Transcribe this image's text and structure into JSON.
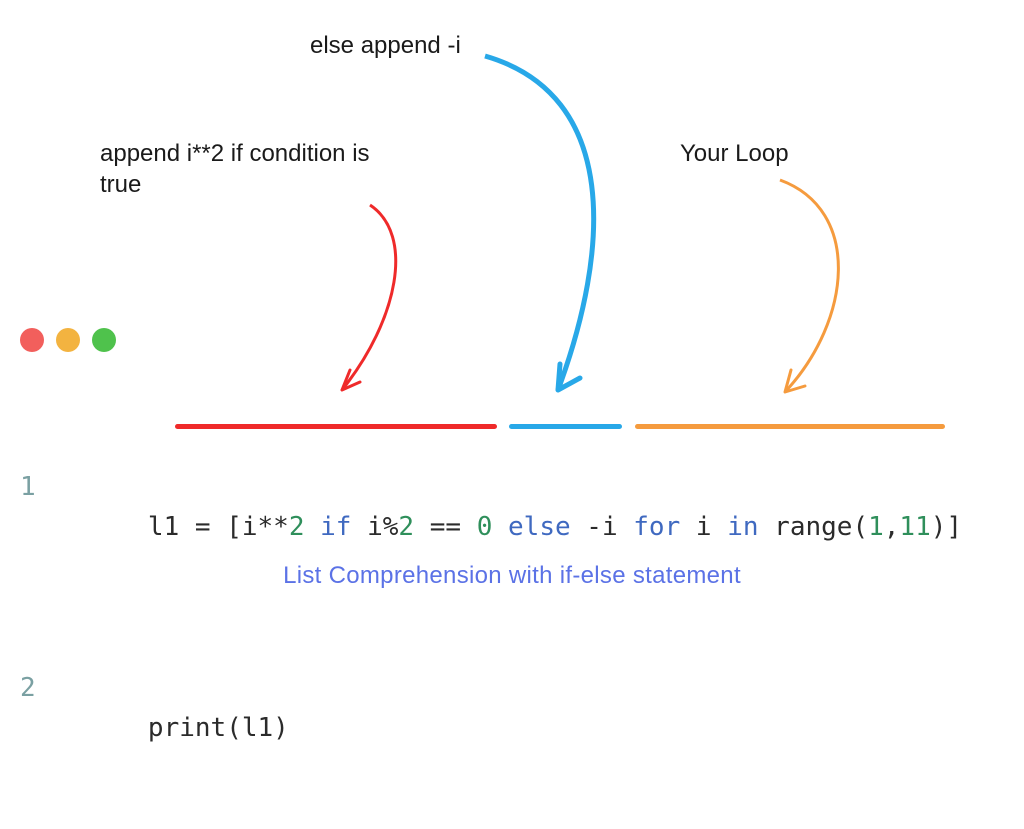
{
  "annotations": {
    "if": "append i**2 if condition is true",
    "else": "else append -i",
    "loop": "Your Loop"
  },
  "dots": {
    "red": "traffic-red",
    "yellow": "traffic-yellow",
    "green": "traffic-green"
  },
  "code": {
    "line1_no": "1",
    "line2_no": "2",
    "l1": "l1",
    "eq": " = ",
    "lb": "[",
    "i": "i",
    "starstar": "**",
    "two": "2",
    "sp": " ",
    "if": "if",
    "pct": "%",
    "eqeq": " == ",
    "zero": "0",
    "else": "else",
    "minus": " -",
    "for": "for",
    "in": "in",
    "range": "range",
    "lp": "(",
    "one": "1",
    "comma": ",",
    "eleven": "11",
    "rp": ")",
    "rb": "]",
    "print": "print",
    "printarg": "(l1)"
  },
  "caption": "List Comprehension with if-else statement",
  "colors": {
    "arrow_if": "#ef2a2a",
    "arrow_else": "#28a8e8",
    "arrow_loop": "#f59b3e"
  }
}
